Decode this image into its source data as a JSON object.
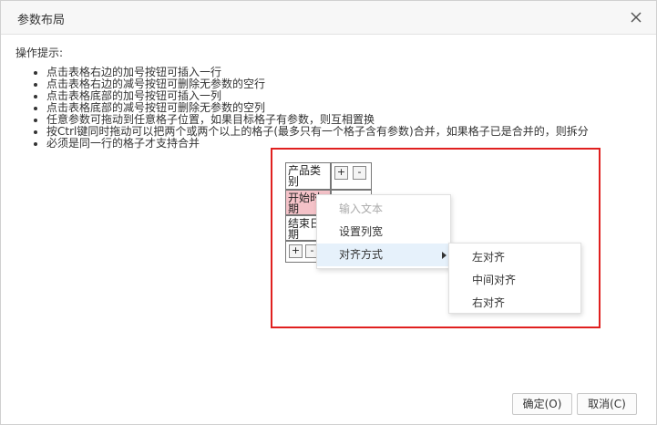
{
  "dialog": {
    "title": "参数布局",
    "close_icon": "close-icon"
  },
  "tips": {
    "heading": "操作提示:",
    "items": [
      "点击表格右边的加号按钮可插入一行",
      "点击表格右边的减号按钮可删除无参数的空行",
      "点击表格底部的加号按钮可插入一列",
      "点击表格底部的减号按钮可删除无参数的空列",
      "任意参数可拖动到任意格子位置，如果目标格子有参数，则互相置换",
      "按Ctrl键同时拖动可以把两个或两个以上的格子(最多只有一个格子含有参数)合并，如果格子已是合并的，则拆分",
      "必须是同一行的格子才支持合并"
    ]
  },
  "param_table": {
    "cells": [
      "产品类别",
      "开始时期",
      "结束日期"
    ],
    "add_label": "+",
    "remove_label": "-"
  },
  "context_menu": {
    "items": [
      "输入文本",
      "设置列宽",
      "对齐方式"
    ],
    "submenu": [
      "左对齐",
      "中间对齐",
      "右对齐"
    ]
  },
  "footer": {
    "ok_label": "确定(O)",
    "cancel_label": "取消(C)"
  },
  "colors": {
    "highlight_border": "#e0201f",
    "selected_cell": "#f4c2c8",
    "menu_hover": "#e6f1fb"
  }
}
